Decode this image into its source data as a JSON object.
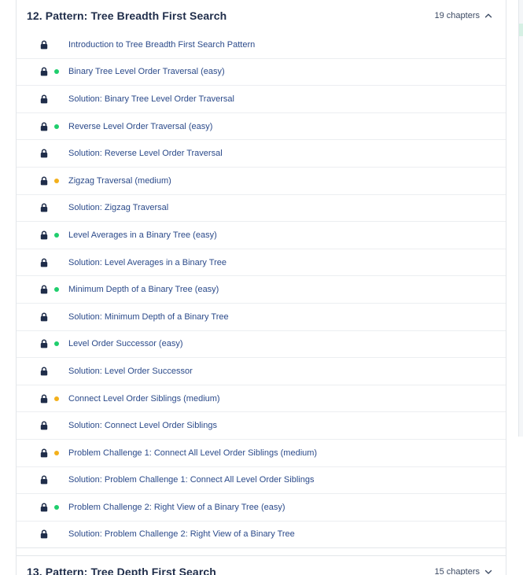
{
  "current_section": {
    "title": "12.  Pattern: Tree Breadth First Search",
    "chapters": "19 chapters",
    "expanded_icon": "chevron-up-icon",
    "items": [
      {
        "label": "Introduction to Tree Breadth First Search Pattern",
        "difficulty": ""
      },
      {
        "label": "Binary Tree Level Order Traversal (easy)",
        "difficulty": "easy"
      },
      {
        "label": "Solution: Binary Tree Level Order Traversal",
        "difficulty": ""
      },
      {
        "label": "Reverse Level Order Traversal (easy)",
        "difficulty": "easy"
      },
      {
        "label": "Solution: Reverse Level Order Traversal",
        "difficulty": ""
      },
      {
        "label": "Zigzag Traversal (medium)",
        "difficulty": "medium"
      },
      {
        "label": "Solution: Zigzag Traversal",
        "difficulty": ""
      },
      {
        "label": "Level Averages in a Binary Tree (easy)",
        "difficulty": "easy"
      },
      {
        "label": "Solution: Level Averages in a Binary Tree",
        "difficulty": ""
      },
      {
        "label": "Minimum Depth of a Binary Tree (easy)",
        "difficulty": "easy"
      },
      {
        "label": "Solution: Minimum Depth of a Binary Tree",
        "difficulty": ""
      },
      {
        "label": "Level Order Successor (easy)",
        "difficulty": "easy"
      },
      {
        "label": "Solution: Level Order Successor",
        "difficulty": ""
      },
      {
        "label": "Connect Level Order Siblings (medium)",
        "difficulty": "medium"
      },
      {
        "label": "Solution: Connect Level Order Siblings",
        "difficulty": ""
      },
      {
        "label": "Problem Challenge 1: Connect All Level Order Siblings (medium)",
        "difficulty": "medium"
      },
      {
        "label": "Solution: Problem Challenge 1: Connect All Level Order Siblings",
        "difficulty": ""
      },
      {
        "label": "Problem Challenge 2: Right View of a Binary Tree (easy)",
        "difficulty": "easy"
      },
      {
        "label": "Solution: Problem Challenge 2: Right View of a Binary Tree",
        "difficulty": ""
      }
    ]
  },
  "next_section": {
    "title": "13.  Pattern: Tree Depth First Search",
    "chapters": "15 chapters",
    "collapsed_icon": "chevron-down-icon"
  },
  "icons": {
    "row_icon": "lock-icon"
  },
  "colors": {
    "easy": "#1fce6d",
    "medium": "#f3b01b",
    "link": "#2b4a8a",
    "lock": "#1f2d4a"
  }
}
